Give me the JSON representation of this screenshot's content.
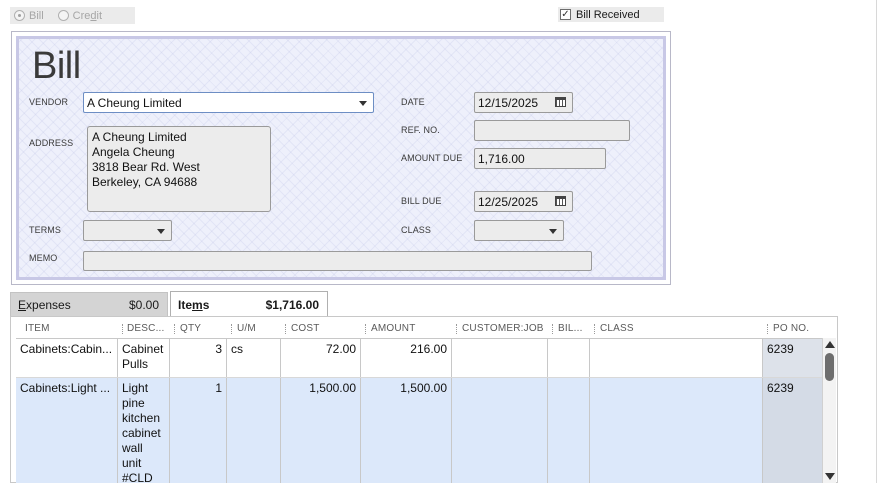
{
  "bill_type": {
    "options": [
      {
        "label": "Bill",
        "selected": true
      },
      {
        "label": "Credit",
        "selected": false
      }
    ]
  },
  "bill_received": {
    "label": "Bill Received",
    "checked": true
  },
  "form": {
    "title": "Bill",
    "vendor_label": "VENDOR",
    "vendor_value": "A Cheung Limited",
    "address_label": "ADDRESS",
    "address_lines": [
      "A Cheung Limited",
      "Angela Cheung",
      "3818 Bear Rd. West",
      "Berkeley, CA 94688"
    ],
    "terms_label": "TERMS",
    "terms_value": "",
    "memo_label": "MEMO",
    "memo_value": "",
    "date_label": "DATE",
    "date_value": "12/15/2025",
    "ref_label": "REF. NO.",
    "ref_value": "",
    "amount_due_label": "AMOUNT DUE",
    "amount_due_value": "1,716.00",
    "bill_due_label": "BILL DUE",
    "bill_due_value": "12/25/2025",
    "class_label": "CLASS",
    "class_value": ""
  },
  "tabs": [
    {
      "label_prefix": "E",
      "label_rest": "xpenses",
      "amount": "$0.00",
      "active": false
    },
    {
      "label_prefix": "Ite",
      "label_mid": "m",
      "label_rest": "s",
      "amount": "$1,716.00",
      "active": true
    }
  ],
  "grid": {
    "columns": [
      "ITEM",
      "DESC...",
      "QTY",
      "U/M",
      "COST",
      "AMOUNT",
      "CUSTOMER:JOB",
      "BIL...",
      "CLASS",
      "PO NO."
    ],
    "rows": [
      {
        "item": "Cabinets:Cabin...",
        "description": "Cabinet Pulls",
        "qty": "3",
        "um": "cs",
        "cost": "72.00",
        "amount": "216.00",
        "customer_job": "",
        "billable": "",
        "class": "",
        "po_no": "6239"
      },
      {
        "item": "Cabinets:Light ...",
        "description": "Light pine kitchen cabinet wall unit #CLD",
        "qty": "1",
        "um": "",
        "cost": "1,500.00",
        "amount": "1,500.00",
        "customer_job": "",
        "billable": "",
        "class": "",
        "po_no": "6239"
      }
    ]
  },
  "colors": {
    "panel_background": "#eef0fb",
    "panel_border": "#c8c8e6",
    "selected_row": "#dce8fa",
    "po_column": "#d4dbe6"
  }
}
